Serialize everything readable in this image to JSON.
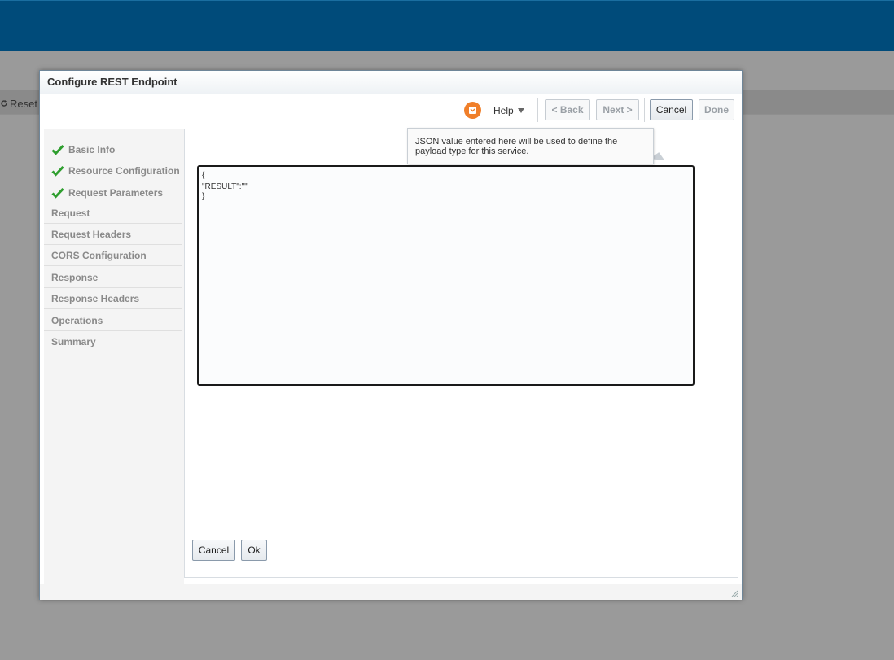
{
  "background": {
    "reset_label": "Reset"
  },
  "dialog": {
    "title": "Configure REST Endpoint",
    "toolbar": {
      "help_label": "Help",
      "back_label": "< Back",
      "next_label": "Next >",
      "cancel_label": "Cancel",
      "done_label": "Done"
    },
    "nav": {
      "items": [
        {
          "label": "Basic Info",
          "completed": true
        },
        {
          "label": "Resource Configuration",
          "completed": true
        },
        {
          "label": "Request Parameters",
          "completed": true
        },
        {
          "label": "Request",
          "completed": false
        },
        {
          "label": "Request Headers",
          "completed": false
        },
        {
          "label": "CORS Configuration",
          "completed": false
        },
        {
          "label": "Response",
          "completed": false
        },
        {
          "label": "Response Headers",
          "completed": false
        },
        {
          "label": "Operations",
          "completed": false
        },
        {
          "label": "Summary",
          "completed": false
        }
      ]
    },
    "tooltip": "JSON value entered here will be used to define the payload type for this service.",
    "json_editor": {
      "lines": [
        "{",
        "\"RESULT\":\"\"",
        "}"
      ]
    },
    "content_buttons": {
      "cancel_label": "Cancel",
      "ok_label": "Ok"
    }
  },
  "colors": {
    "topbar": "#004b7a",
    "status_icon": "#f07f2a",
    "check": "#2e9e2e"
  },
  "icons": [
    "reset-icon",
    "status-icon",
    "help-caret-icon",
    "check-icon",
    "resize-grip-icon"
  ]
}
